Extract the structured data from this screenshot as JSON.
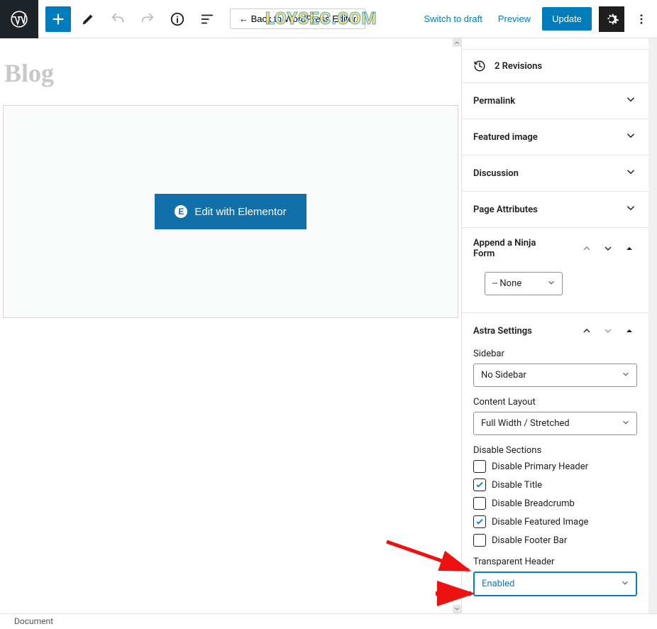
{
  "toolbar": {
    "back_label": "← Back to WordPress Editor",
    "switch_draft": "Switch to draft",
    "preview": "Preview",
    "update": "Update"
  },
  "watermark": "LOYSEC.COM",
  "page_title": "Blog",
  "elementor_button": "Edit with Elementor",
  "sidebar": {
    "revisions_label": "2 Revisions",
    "panels": {
      "permalink": "Permalink",
      "featured_image": "Featured image",
      "discussion": "Discussion",
      "page_attributes": "Page Attributes",
      "append_ninja": "Append a Ninja Form",
      "astra": "Astra Settings"
    },
    "ninja_select": "-- None",
    "astra": {
      "sidebar_label": "Sidebar",
      "sidebar_value": "No Sidebar",
      "content_layout_label": "Content Layout",
      "content_layout_value": "Full Width / Stretched",
      "disable_sections_label": "Disable Sections",
      "checks": {
        "primary_header": "Disable Primary Header",
        "title": "Disable Title",
        "breadcrumb": "Disable Breadcrumb",
        "featured_image": "Disable Featured Image",
        "footer_bar": "Disable Footer Bar"
      },
      "transparent_header_label": "Transparent Header",
      "transparent_header_value": "Enabled"
    }
  },
  "statusbar": "Document"
}
